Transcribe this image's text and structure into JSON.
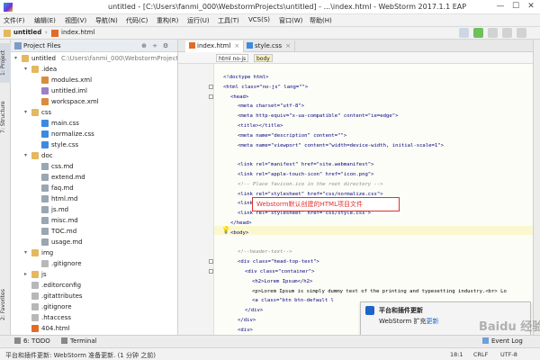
{
  "window": {
    "title": "untitled - [C:\\Users\\fanmi_000\\WebstormProjects\\untitled] - ...\\index.html - WebStorm 2017.1.1 EAP",
    "minimize": "—",
    "maximize": "☐",
    "close": "✕"
  },
  "menu": [
    "文件(F)",
    "编辑(E)",
    "视图(V)",
    "导航(N)",
    "代码(C)",
    "重构(R)",
    "运行(U)",
    "工具(T)",
    "VCS(S)",
    "窗口(W)",
    "帮助(H)"
  ],
  "breadcrumb": [
    "untitled",
    "index.html"
  ],
  "left_tabs": {
    "project": "1: Project",
    "structure": "7: Structure",
    "favorites": "2: Favorites"
  },
  "project_panel": {
    "title": "Project Files",
    "root_name": "untitled",
    "root_path": "C:\\Users\\fanmi_000\\WebstormProjects\\untitled",
    "items": [
      {
        "label": "untitled",
        "depth": 0,
        "kind": "folder",
        "expanded": true
      },
      {
        "label": ".idea",
        "depth": 1,
        "kind": "folder",
        "expanded": true
      },
      {
        "label": "modules.xml",
        "depth": 2,
        "kind": "xml"
      },
      {
        "label": "untitled.iml",
        "depth": 2,
        "kind": "iml"
      },
      {
        "label": "workspace.xml",
        "depth": 2,
        "kind": "xml"
      },
      {
        "label": "css",
        "depth": 1,
        "kind": "folder",
        "expanded": true
      },
      {
        "label": "main.css",
        "depth": 2,
        "kind": "css"
      },
      {
        "label": "normalize.css",
        "depth": 2,
        "kind": "css"
      },
      {
        "label": "style.css",
        "depth": 2,
        "kind": "css"
      },
      {
        "label": "doc",
        "depth": 1,
        "kind": "folder",
        "expanded": true
      },
      {
        "label": "css.md",
        "depth": 2,
        "kind": "md"
      },
      {
        "label": "extend.md",
        "depth": 2,
        "kind": "md"
      },
      {
        "label": "faq.md",
        "depth": 2,
        "kind": "md"
      },
      {
        "label": "html.md",
        "depth": 2,
        "kind": "md"
      },
      {
        "label": "js.md",
        "depth": 2,
        "kind": "md"
      },
      {
        "label": "misc.md",
        "depth": 2,
        "kind": "md"
      },
      {
        "label": "TOC.md",
        "depth": 2,
        "kind": "md"
      },
      {
        "label": "usage.md",
        "depth": 2,
        "kind": "md"
      },
      {
        "label": "img",
        "depth": 1,
        "kind": "folder",
        "expanded": true
      },
      {
        "label": ".gitignore",
        "depth": 2,
        "kind": "text"
      },
      {
        "label": "js",
        "depth": 1,
        "kind": "folder",
        "expanded": false
      },
      {
        "label": ".editorconfig",
        "depth": 1,
        "kind": "text"
      },
      {
        "label": ".gitattributes",
        "depth": 1,
        "kind": "text"
      },
      {
        "label": ".gitignore",
        "depth": 1,
        "kind": "text"
      },
      {
        "label": ".htaccess",
        "depth": 1,
        "kind": "text"
      },
      {
        "label": "404.html",
        "depth": 1,
        "kind": "html"
      }
    ]
  },
  "editor": {
    "tabs": [
      {
        "label": "index.html",
        "active": true
      },
      {
        "label": "style.css",
        "active": false
      }
    ],
    "tag_path": [
      "html no-js",
      "body"
    ],
    "lines": [
      {
        "text": "<!doctype html>",
        "indent": 0,
        "cls": ""
      },
      {
        "text": "<html class=\"no-js\" lang=\"\">",
        "indent": 0,
        "cls": ""
      },
      {
        "text": "<head>",
        "indent": 1,
        "cls": ""
      },
      {
        "text": "<meta charset=\"utf-8\">",
        "indent": 2,
        "cls": ""
      },
      {
        "text": "<meta http-equiv=\"x-ua-compatible\" content=\"ie=edge\">",
        "indent": 2,
        "cls": ""
      },
      {
        "text": "<title></title>",
        "indent": 2,
        "cls": ""
      },
      {
        "text": "<meta name=\"description\" content=\"\">",
        "indent": 2,
        "cls": ""
      },
      {
        "text": "<meta name=\"viewport\" content=\"width=device-width, initial-scale=1\">",
        "indent": 2,
        "cls": ""
      },
      {
        "text": "",
        "indent": 0,
        "cls": ""
      },
      {
        "text": "<link rel=\"manifest\" href=\"site.webmanifest\">",
        "indent": 2,
        "cls": ""
      },
      {
        "text": "<link rel=\"apple-touch-icon\" href=\"icon.png\">",
        "indent": 2,
        "cls": ""
      },
      {
        "text": "<!-- Place favicon.ico in the root directory -->",
        "indent": 2,
        "cls": "comment"
      },
      {
        "text": "<link rel=\"stylesheet\" href=\"css/normalize.css\">",
        "indent": 2,
        "cls": ""
      },
      {
        "text": "<link rel=\"stylesheet\" href=\"css/main.css\">",
        "indent": 2,
        "cls": ""
      },
      {
        "text": "<link rel=\"stylesheet\" href=\"css/style.css\">",
        "indent": 2,
        "cls": ""
      },
      {
        "text": "</head>",
        "indent": 1,
        "cls": ""
      },
      {
        "text": "<body>",
        "indent": 1,
        "cls": ""
      },
      {
        "text": "",
        "indent": 0,
        "cls": ""
      },
      {
        "text": "<!--header-text-->",
        "indent": 2,
        "cls": "comment"
      },
      {
        "text": "<div class=\"head-top-text\">",
        "indent": 2,
        "cls": ""
      },
      {
        "text": "<div class=\"container\">",
        "indent": 3,
        "cls": ""
      },
      {
        "text": "<h2>Lorem Ipsum</h2>",
        "indent": 4,
        "cls": ""
      },
      {
        "text": "<p>Lorem Ipsum is simply dummy text of the printing and typesetting industry.<br> Lo",
        "indent": 4,
        "cls": "txt"
      },
      {
        "text": "<a class=\"btn btn-default l",
        "indent": 4,
        "cls": ""
      },
      {
        "text": "</div>",
        "indent": 3,
        "cls": ""
      },
      {
        "text": "</div>",
        "indent": 2,
        "cls": ""
      },
      {
        "text": "<div>",
        "indent": 2,
        "cls": ""
      }
    ]
  },
  "annotation": {
    "callout": "Webstorm默认创建的HTML项目文件"
  },
  "notification": {
    "title": "平台和插件更新",
    "body_prefix": "WebStorm 扩充",
    "link": "更新"
  },
  "watermark": "Baidu 经验",
  "bottom_tools": {
    "todo": "6: TODO",
    "terminal": "Terminal",
    "event_log": "Event Log"
  },
  "status": {
    "message": "平台和插件更新: WebStorm 准备更新. (1 分钟 之前)",
    "position": "18:1",
    "line_sep": "CRLF",
    "encoding": "UTF-8"
  },
  "colors": {
    "accent": "#1e63c9",
    "callout": "#e0312b",
    "highlight_line": "#fbf8d0"
  }
}
